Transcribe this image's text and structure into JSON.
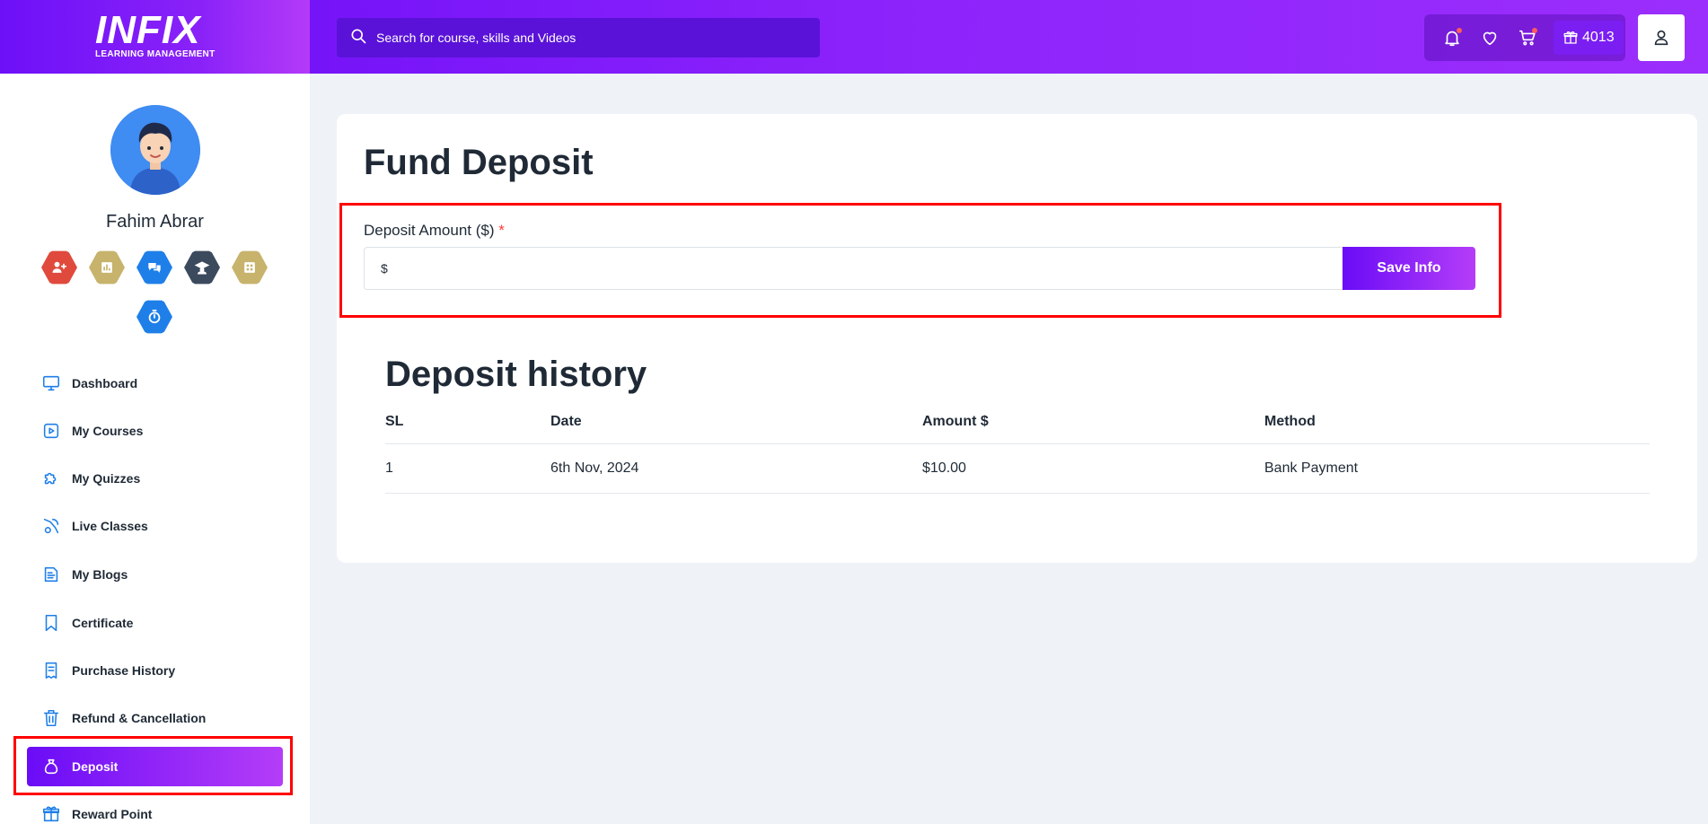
{
  "header": {
    "logo_text": "INFIX",
    "logo_subtitle": "LEARNING MANAGEMENT",
    "search_placeholder": "Search for course, skills and Videos",
    "points": "4013"
  },
  "sidebar": {
    "user_name": "Fahim Abrar",
    "badge_icons": [
      "user-plus-icon",
      "chart-icon",
      "chat-icon",
      "graduate-icon",
      "grid-icon",
      "timer-icon"
    ],
    "items": [
      {
        "label": "Dashboard",
        "icon": "monitor-icon"
      },
      {
        "label": "My Courses",
        "icon": "play-icon"
      },
      {
        "label": "My Quizzes",
        "icon": "puzzle-icon"
      },
      {
        "label": "Live Classes",
        "icon": "live-icon"
      },
      {
        "label": "My Blogs",
        "icon": "blog-icon"
      },
      {
        "label": "Certificate",
        "icon": "bookmark-icon"
      },
      {
        "label": "Purchase History",
        "icon": "receipt-icon"
      },
      {
        "label": "Refund & Cancellation",
        "icon": "trash-icon"
      },
      {
        "label": "Deposit",
        "icon": "money-bag-icon",
        "active": true
      },
      {
        "label": "Reward Point",
        "icon": "gift-icon"
      }
    ]
  },
  "main": {
    "title": "Fund Deposit",
    "amount_label": "Deposit Amount ($)",
    "required_mark": "*",
    "currency_prefix": "$",
    "save_label": "Save Info",
    "history_title": "Deposit history",
    "table": {
      "headers": [
        "SL",
        "Date",
        "Amount $",
        "Method"
      ],
      "rows": [
        [
          "1",
          "6th Nov, 2024",
          "$10.00",
          "Bank Payment"
        ]
      ]
    }
  },
  "colors": {
    "accent": "#6a0cf7",
    "accent_end": "#b53df8",
    "highlight": "#ff0000"
  }
}
